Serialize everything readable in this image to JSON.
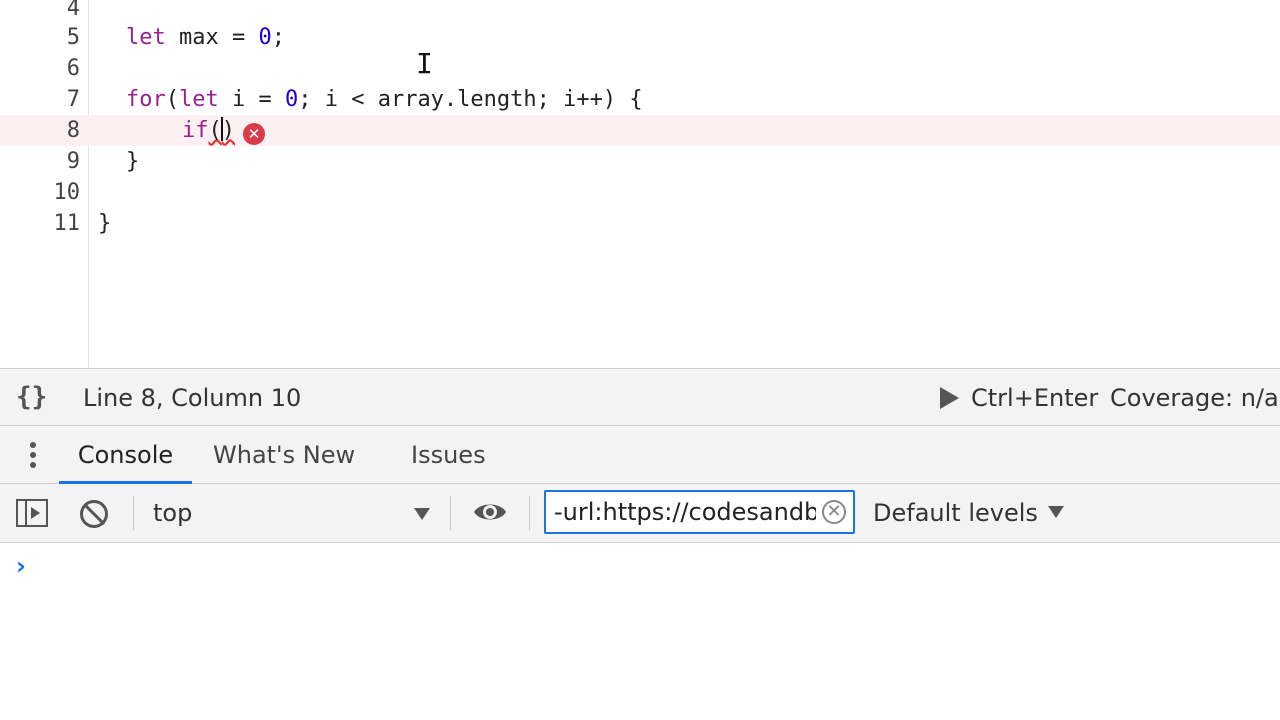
{
  "editor": {
    "lines": [
      {
        "number": "4"
      },
      {
        "number": "5"
      },
      {
        "number": "6"
      },
      {
        "number": "7"
      },
      {
        "number": "8"
      },
      {
        "number": "9"
      },
      {
        "number": "10"
      },
      {
        "number": "11"
      }
    ],
    "tokens": {
      "let": "let",
      "max": " max = ",
      "zero": "0",
      "semi": ";",
      "for": "for",
      "paren_open": "(",
      "let2": "let",
      "i_eq": " i = ",
      "zero2": "0",
      "cond": "; i < array.length; i++) {",
      "if": "if",
      "if_parens_open": "(",
      "if_parens_close": ")",
      "close_brace_inner": "}",
      "close_brace_outer": "}"
    },
    "error_icon_glyph": "✕"
  },
  "statusbar": {
    "pretty_print_glyph": "{}",
    "cursor_position": "Line 8, Column 10",
    "run_shortcut": "Ctrl+Enter",
    "coverage": "Coverage: n/a"
  },
  "drawer": {
    "tabs": [
      {
        "label": "Console"
      },
      {
        "label": "What's New"
      },
      {
        "label": "Issues"
      }
    ]
  },
  "console_toolbar": {
    "context": "top",
    "filter_value": "-url:https://codesandbox.io",
    "filter_clear_glyph": "✕",
    "levels": "Default levels"
  },
  "console": {
    "prompt_glyph": "›"
  },
  "icons": {
    "pretty_print": "curly-braces-icon",
    "run": "play-icon",
    "drawer_menu": "kebab-menu-icon",
    "sidebar": "sidebar-toggle-icon",
    "clear": "clear-console-icon",
    "live_expression": "eye-icon",
    "error": "error-circle-icon"
  },
  "colors": {
    "accent": "#1a73e8",
    "error": "#d93b48",
    "error_line_bg": "#fdf0f2",
    "keyword": "#9b1f91",
    "number": "#1c00cf"
  }
}
